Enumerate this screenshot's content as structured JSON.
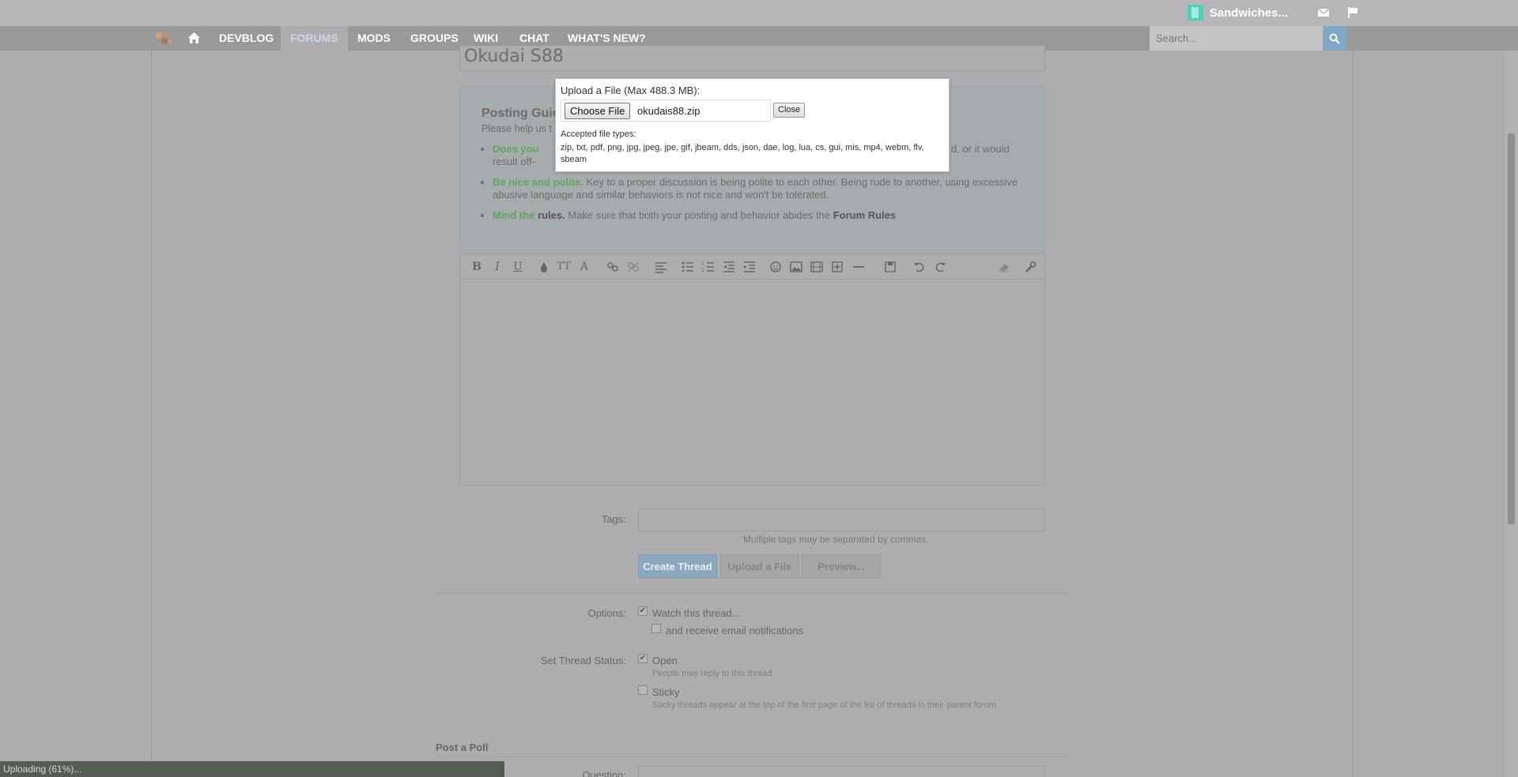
{
  "topbar": {
    "username": "Sandwiches...",
    "icons": [
      "avatar-icon",
      "mail-icon",
      "flag-icon"
    ]
  },
  "nav": {
    "tabs": [
      {
        "label": "DEVBLOG",
        "active": false
      },
      {
        "label": "FORUMS",
        "active": true
      },
      {
        "label": "MODS",
        "active": false
      },
      {
        "label": "GROUPS",
        "active": false
      },
      {
        "label": "WIKI",
        "active": false
      },
      {
        "label": "CHAT",
        "active": false
      },
      {
        "label": "WHAT'S NEW?",
        "active": false
      }
    ],
    "search_placeholder": "Search..."
  },
  "thread": {
    "title_value": "Okudai S88"
  },
  "guidelines": {
    "title": "Posting Guic",
    "subtitle": "Please help us t",
    "items": [
      {
        "lead": "Does you",
        "text": "d, or it would",
        "text2": "result off-"
      },
      {
        "lead": "Be nice and polite.",
        "text": " Key to a proper discussion is being polite to each other. Being rude to another, using excessive abusive language and similar behaviors is not nice and won't be tolerated."
      },
      {
        "lead": "Mind the",
        "bold": "rules.",
        "text": " Make sure that both your posting and behavior abides the ",
        "link": "Forum Rules"
      }
    ]
  },
  "upload_dialog": {
    "title": "Upload a File (Max 488.3 MB):",
    "choose_label": "Choose File",
    "file_name": "okudais88.zip",
    "close_label": "Close",
    "types_label": "Accepted file types:",
    "types": "zip, txt, pdf, png, jpg, jpeg, jpe, gif, jbeam, dds, json, dae, log, lua, cs, gui, mis, mp4, webm, flv, sbeam"
  },
  "form": {
    "tags_label": "Tags:",
    "tags_hint": "Multiple tags may be separated by commas.",
    "create_label": "Create Thread",
    "upload_label": "Upload a File",
    "preview_label": "Preview...",
    "options_label": "Options:",
    "watch_label": "Watch this thread...",
    "watch_checked": true,
    "email_label": "and receive email notifications",
    "email_checked": false,
    "status_label": "Set Thread Status:",
    "open_label": "Open",
    "open_checked": true,
    "open_hint": "People may reply to this thread",
    "sticky_label": "Sticky",
    "sticky_checked": false,
    "sticky_hint": "Sticky threads appear at the top of the first page of the list of threads in their parent forum",
    "poll_heading": "Post a Poll",
    "question_label": "Question:"
  },
  "status_bar": {
    "text": "Uploading (61%)..."
  }
}
